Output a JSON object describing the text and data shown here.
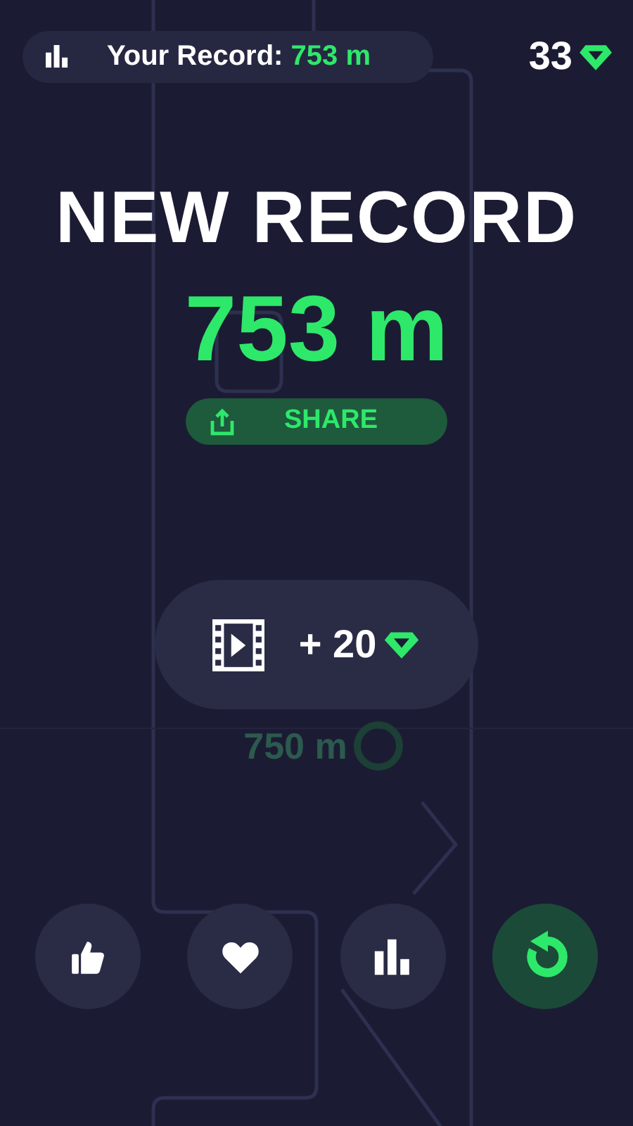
{
  "record_bar": {
    "label": "Your Record:",
    "value": "753 m"
  },
  "gems": {
    "count": "33"
  },
  "title": "NEW RECORD",
  "score": "753 m",
  "share_button": {
    "label": "SHARE"
  },
  "video_reward": {
    "amount": "+ 20"
  },
  "track_marker": {
    "distance": "750 m"
  },
  "actions": [
    {
      "kind": "like"
    },
    {
      "kind": "favorite"
    },
    {
      "kind": "leaderboard"
    },
    {
      "kind": "restart"
    }
  ]
}
